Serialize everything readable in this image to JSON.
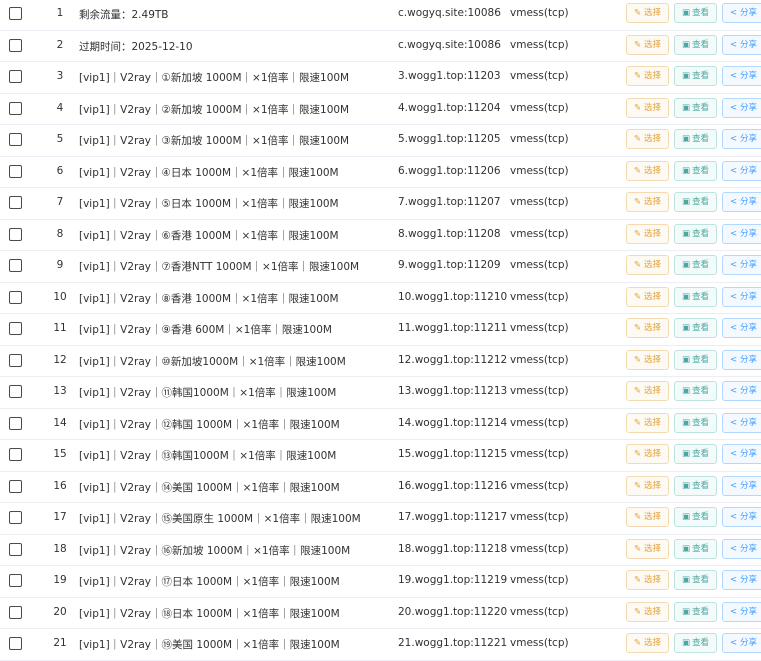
{
  "actions": {
    "select_label": "选择",
    "view_label": "查看",
    "share_label": "分享",
    "select_icon": "edit-icon",
    "view_icon": "view-icon",
    "share_icon": "share-icon"
  },
  "colors": {
    "select": "#e6a23c",
    "view": "#4aa8a0",
    "share": "#409eff"
  },
  "rows": [
    {
      "idx": "1",
      "name": "剩余流量：2.49TB",
      "addr": "c.wogyq.site:10086",
      "proto": "vmess(tcp)"
    },
    {
      "idx": "2",
      "name": "过期时间：2025-12-10",
      "addr": "c.wogyq.site:10086",
      "proto": "vmess(tcp)"
    },
    {
      "idx": "3",
      "name": "[vip1]｜V2ray｜①新加坡 1000M｜×1倍率｜限速100M",
      "addr": "3.wogg1.top:11203",
      "proto": "vmess(tcp)"
    },
    {
      "idx": "4",
      "name": "[vip1]｜V2ray｜②新加坡 1000M｜×1倍率｜限速100M",
      "addr": "4.wogg1.top:11204",
      "proto": "vmess(tcp)"
    },
    {
      "idx": "5",
      "name": "[vip1]｜V2ray｜③新加坡 1000M｜×1倍率｜限速100M",
      "addr": "5.wogg1.top:11205",
      "proto": "vmess(tcp)"
    },
    {
      "idx": "6",
      "name": "[vip1]｜V2ray｜④日本 1000M｜×1倍率｜限速100M",
      "addr": "6.wogg1.top:11206",
      "proto": "vmess(tcp)"
    },
    {
      "idx": "7",
      "name": "[vip1]｜V2ray｜⑤日本 1000M｜×1倍率｜限速100M",
      "addr": "7.wogg1.top:11207",
      "proto": "vmess(tcp)"
    },
    {
      "idx": "8",
      "name": "[vip1]｜V2ray｜⑥香港 1000M｜×1倍率｜限速100M",
      "addr": "8.wogg1.top:11208",
      "proto": "vmess(tcp)"
    },
    {
      "idx": "9",
      "name": "[vip1]｜V2ray｜⑦香港NTT 1000M｜×1倍率｜限速100M",
      "addr": "9.wogg1.top:11209",
      "proto": "vmess(tcp)"
    },
    {
      "idx": "10",
      "name": "[vip1]｜V2ray｜⑧香港 1000M｜×1倍率｜限速100M",
      "addr": "10.wogg1.top:11210",
      "proto": "vmess(tcp)"
    },
    {
      "idx": "11",
      "name": "[vip1]｜V2ray｜⑨香港 600M｜×1倍率｜限速100M",
      "addr": "11.wogg1.top:11211",
      "proto": "vmess(tcp)"
    },
    {
      "idx": "12",
      "name": "[vip1]｜V2ray｜⑩新加坡1000M｜×1倍率｜限速100M",
      "addr": "12.wogg1.top:11212",
      "proto": "vmess(tcp)"
    },
    {
      "idx": "13",
      "name": "[vip1]｜V2ray｜⑪韩国1000M｜×1倍率｜限速100M",
      "addr": "13.wogg1.top:11213",
      "proto": "vmess(tcp)"
    },
    {
      "idx": "14",
      "name": "[vip1]｜V2ray｜⑫韩国 1000M｜×1倍率｜限速100M",
      "addr": "14.wogg1.top:11214",
      "proto": "vmess(tcp)"
    },
    {
      "idx": "15",
      "name": "[vip1]｜V2ray｜⑬韩国1000M｜×1倍率｜限速100M",
      "addr": "15.wogg1.top:11215",
      "proto": "vmess(tcp)"
    },
    {
      "idx": "16",
      "name": "[vip1]｜V2ray｜⑭美国 1000M｜×1倍率｜限速100M",
      "addr": "16.wogg1.top:11216",
      "proto": "vmess(tcp)"
    },
    {
      "idx": "17",
      "name": "[vip1]｜V2ray｜⑮美国原生 1000M｜×1倍率｜限速100M",
      "addr": "17.wogg1.top:11217",
      "proto": "vmess(tcp)"
    },
    {
      "idx": "18",
      "name": "[vip1]｜V2ray｜⑯新加坡 1000M｜×1倍率｜限速100M",
      "addr": "18.wogg1.top:11218",
      "proto": "vmess(tcp)"
    },
    {
      "idx": "19",
      "name": "[vip1]｜V2ray｜⑰日本 1000M｜×1倍率｜限速100M",
      "addr": "19.wogg1.top:11219",
      "proto": "vmess(tcp)"
    },
    {
      "idx": "20",
      "name": "[vip1]｜V2ray｜⑱日本 1000M｜×1倍率｜限速100M",
      "addr": "20.wogg1.top:11220",
      "proto": "vmess(tcp)"
    },
    {
      "idx": "21",
      "name": "[vip1]｜V2ray｜⑲美国 1000M｜×1倍率｜限速100M",
      "addr": "21.wogg1.top:11221",
      "proto": "vmess(tcp)"
    }
  ]
}
